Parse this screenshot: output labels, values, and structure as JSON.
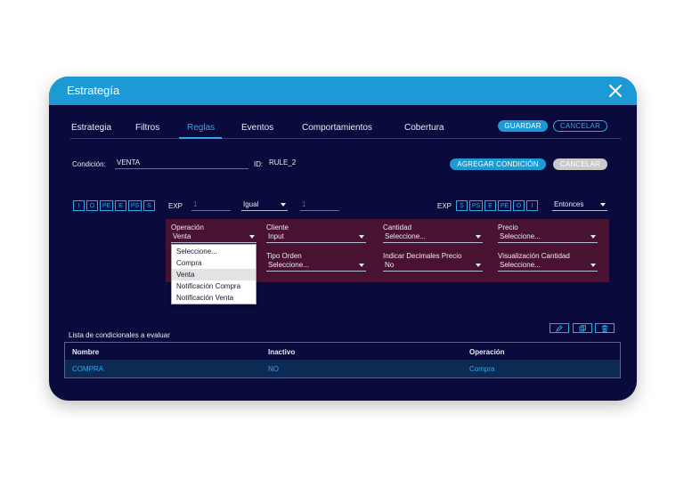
{
  "window": {
    "title": "Estrategía"
  },
  "tabs": [
    {
      "label": "Estrategia"
    },
    {
      "label": "Filtros"
    },
    {
      "label": "Reglas"
    },
    {
      "label": "Eventos"
    },
    {
      "label": "Comportamientos"
    },
    {
      "label": "Cobertura"
    }
  ],
  "actions": {
    "save": "GUARDAR",
    "cancel": "CANCELAR"
  },
  "condition": {
    "label": "Condición:",
    "value": "VENTA",
    "id_label": "ID:",
    "id_value": "RULE_2",
    "add_button": "AGREGAR CONDICIÓN",
    "cancel_button": "CANCELAR"
  },
  "expression": {
    "left_boxes": [
      "I",
      "O",
      "PE",
      "E",
      "PS",
      "S"
    ],
    "exp_label": "EXP",
    "left_value": "1",
    "operator": "Igual",
    "right_value": "1",
    "right_exp_label": "EXP",
    "right_boxes": [
      "S",
      "PS",
      "E",
      "PE",
      "O",
      "I"
    ],
    "then": "Entonces"
  },
  "rule_fields": {
    "operacion": {
      "label": "Operación",
      "value": "Venta"
    },
    "cliente": {
      "label": "Cliente",
      "value": "Input"
    },
    "cantidad": {
      "label": "Cantidad",
      "value": "Seleccione..."
    },
    "precio": {
      "label": "Precio",
      "value": "Seleccione..."
    },
    "tipo_orden": {
      "label": "Tipo Orden",
      "value": "Seleccione..."
    },
    "decimales": {
      "label": "Indicar Decimales Precio",
      "value": "No"
    },
    "visualizacion": {
      "label": "Visualización Cantidad",
      "value": "Seleccione..."
    }
  },
  "operacion_options": [
    "Seleccione...",
    "Compra",
    "Venta",
    "Notificación Compra",
    "Notificación Venta"
  ],
  "list": {
    "title": "Lista de condicionales a evaluar",
    "columns": [
      "Nombre",
      "Inactivo",
      "Operación"
    ],
    "rows": [
      {
        "nombre": "COMPRA",
        "inactivo": "NO",
        "operacion": "Compra"
      }
    ]
  },
  "icons": [
    "close-icon",
    "edit-icon",
    "copy-icon",
    "trash-icon",
    "chevron-down-icon"
  ],
  "colors": {
    "accent": "#1b9ad6",
    "background": "#0a0a3c",
    "panel": "#4a1231",
    "selected_row": "#0d2a55"
  }
}
